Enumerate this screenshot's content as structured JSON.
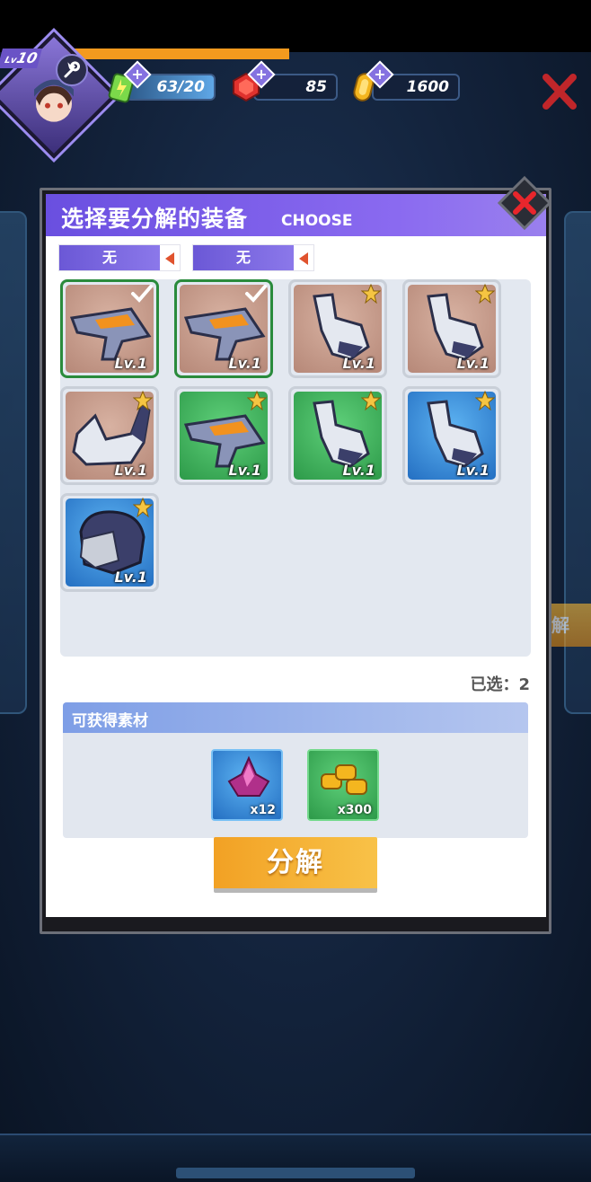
{
  "hud": {
    "player_level": "10",
    "level_prefix": "Lv",
    "stamina": "63/20",
    "gems": "85",
    "gold": "1600"
  },
  "modal": {
    "title": "选择要分解的装备",
    "title_en": "CHOOSE",
    "filters": [
      {
        "label": "无"
      },
      {
        "label": "无"
      }
    ],
    "items": [
      {
        "type": "blaster-icon",
        "rarity": "brown",
        "level": "Lv.1",
        "selected": true
      },
      {
        "type": "blaster-icon",
        "rarity": "brown",
        "level": "Lv.1",
        "selected": true
      },
      {
        "type": "gauntlet-icon",
        "rarity": "brown",
        "level": "Lv.1",
        "selected": false
      },
      {
        "type": "gauntlet-icon",
        "rarity": "brown",
        "level": "Lv.1",
        "selected": false
      },
      {
        "type": "boot-icon",
        "rarity": "brown",
        "level": "Lv.1",
        "selected": false
      },
      {
        "type": "blaster-icon",
        "rarity": "green",
        "level": "Lv.1",
        "selected": false
      },
      {
        "type": "gauntlet-icon",
        "rarity": "green",
        "level": "Lv.1",
        "selected": false
      },
      {
        "type": "gauntlet-icon",
        "rarity": "blue",
        "level": "Lv.1",
        "selected": false
      },
      {
        "type": "helmet-icon",
        "rarity": "blue",
        "level": "Lv.1",
        "selected": false
      }
    ],
    "selected_count": "已选：2",
    "materials_title": "可获得素材",
    "materials": [
      {
        "type": "crystal-icon",
        "qty": "x12",
        "rarity": "blue"
      },
      {
        "type": "gold-coins-icon",
        "qty": "x300",
        "rarity": "green"
      }
    ],
    "decompose_label": "分解"
  },
  "background": {
    "side_button_label": "解"
  },
  "colors": {
    "header_purple": "#6a4fe0",
    "button_orange": "#f2a124",
    "rarity_brown": "#b68878",
    "rarity_green": "#2d9a49",
    "rarity_blue": "#246fc2",
    "check_green": "#2a8b3c"
  }
}
